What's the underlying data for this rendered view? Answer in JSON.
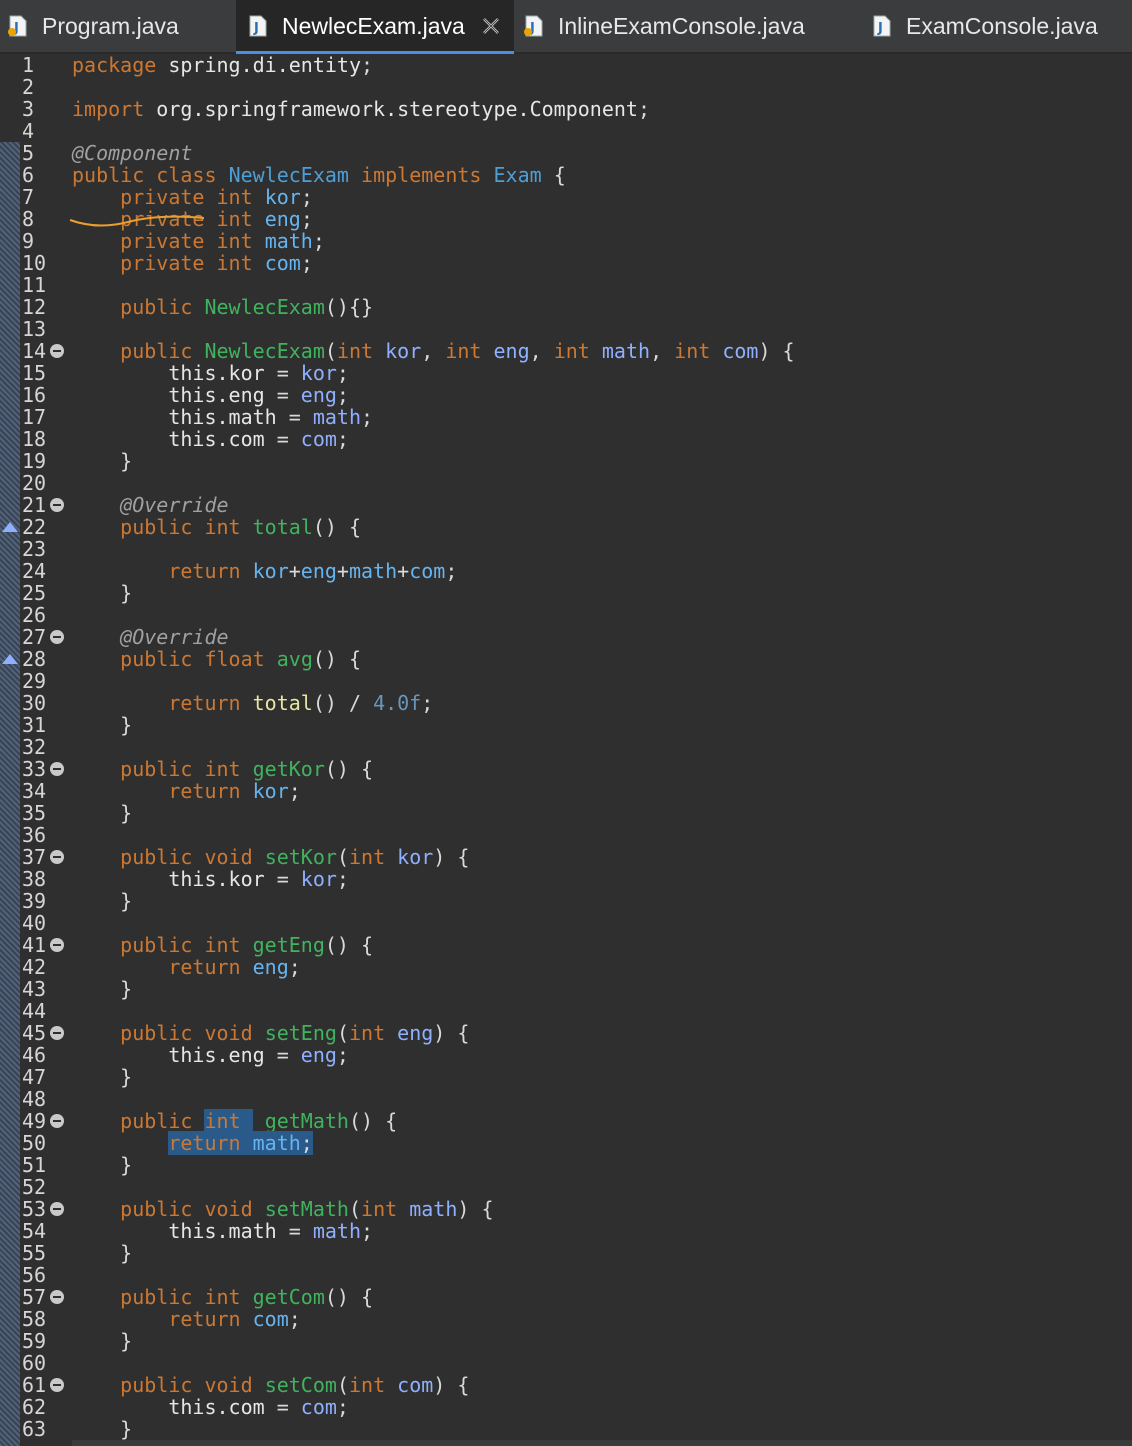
{
  "tabs": [
    {
      "label": "Program.java",
      "active": false,
      "warning": true
    },
    {
      "label": "NewlecExam.java",
      "active": true,
      "closable": true
    },
    {
      "label": "InlineExamConsole.java",
      "active": false,
      "warning": true
    },
    {
      "label": "ExamConsole.java",
      "active": false
    }
  ],
  "colors": {
    "background": "#2f2f2f",
    "keyword": "#cc7832",
    "method": "#3fb35d",
    "field": "#66b4ef",
    "param": "#8fb0ff",
    "selection": "#2a5a8a"
  },
  "icons": {
    "file": "java-file-icon",
    "close": "close-icon",
    "fold": "collapse-icon",
    "override": "override-marker-icon"
  },
  "lines": [
    {
      "n": "1",
      "text": "package spring.di.entity;"
    },
    {
      "n": "2",
      "text": ""
    },
    {
      "n": "3",
      "text": "import org.springframework.stereotype.Component;"
    },
    {
      "n": "4",
      "text": ""
    },
    {
      "n": "5",
      "text": "@Component"
    },
    {
      "n": "6",
      "text": "public class NewlecExam implements Exam {"
    },
    {
      "n": "7",
      "text": "    private int kor;"
    },
    {
      "n": "8",
      "text": "    private int eng;"
    },
    {
      "n": "9",
      "text": "    private int math;"
    },
    {
      "n": "10",
      "text": "    private int com;"
    },
    {
      "n": "11",
      "text": ""
    },
    {
      "n": "12",
      "text": "    public NewlecExam(){}"
    },
    {
      "n": "13",
      "text": ""
    },
    {
      "n": "14",
      "text": "    public NewlecExam(int kor, int eng, int math, int com) {"
    },
    {
      "n": "15",
      "text": "        this.kor = kor;"
    },
    {
      "n": "16",
      "text": "        this.eng = eng;"
    },
    {
      "n": "17",
      "text": "        this.math = math;"
    },
    {
      "n": "18",
      "text": "        this.com = com;"
    },
    {
      "n": "19",
      "text": "    }"
    },
    {
      "n": "20",
      "text": ""
    },
    {
      "n": "21",
      "text": "    @Override"
    },
    {
      "n": "22",
      "text": "    public int total() {"
    },
    {
      "n": "23",
      "text": ""
    },
    {
      "n": "24",
      "text": "        return kor+eng+math+com;"
    },
    {
      "n": "25",
      "text": "    }"
    },
    {
      "n": "26",
      "text": ""
    },
    {
      "n": "27",
      "text": "    @Override"
    },
    {
      "n": "28",
      "text": "    public float avg() {"
    },
    {
      "n": "29",
      "text": ""
    },
    {
      "n": "30",
      "text": "        return total() / 4.0f;"
    },
    {
      "n": "31",
      "text": "    }"
    },
    {
      "n": "32",
      "text": ""
    },
    {
      "n": "33",
      "text": "    public int getKor() {"
    },
    {
      "n": "34",
      "text": "        return kor;"
    },
    {
      "n": "35",
      "text": "    }"
    },
    {
      "n": "36",
      "text": ""
    },
    {
      "n": "37",
      "text": "    public void setKor(int kor) {"
    },
    {
      "n": "38",
      "text": "        this.kor = kor;"
    },
    {
      "n": "39",
      "text": "    }"
    },
    {
      "n": "40",
      "text": ""
    },
    {
      "n": "41",
      "text": "    public int getEng() {"
    },
    {
      "n": "42",
      "text": "        return eng;"
    },
    {
      "n": "43",
      "text": "    }"
    },
    {
      "n": "44",
      "text": ""
    },
    {
      "n": "45",
      "text": "    public void setEng(int eng) {"
    },
    {
      "n": "46",
      "text": "        this.eng = eng;"
    },
    {
      "n": "47",
      "text": "    }"
    },
    {
      "n": "48",
      "text": ""
    },
    {
      "n": "49",
      "text": "    public int getMath() {"
    },
    {
      "n": "50",
      "text": "        return math;"
    },
    {
      "n": "51",
      "text": "    }"
    },
    {
      "n": "52",
      "text": ""
    },
    {
      "n": "53",
      "text": "    public void setMath(int math) {"
    },
    {
      "n": "54",
      "text": "        this.math = math;"
    },
    {
      "n": "55",
      "text": "    }"
    },
    {
      "n": "56",
      "text": ""
    },
    {
      "n": "57",
      "text": "    public int getCom() {"
    },
    {
      "n": "58",
      "text": "        return com;"
    },
    {
      "n": "59",
      "text": "    }"
    },
    {
      "n": "60",
      "text": ""
    },
    {
      "n": "61",
      "text": "    public void setCom(int com) {"
    },
    {
      "n": "62",
      "text": "        this.com = com;"
    },
    {
      "n": "63",
      "text": "    }"
    }
  ],
  "folds": [
    "14",
    "21",
    "27",
    "33",
    "37",
    "41",
    "45",
    "49",
    "53",
    "57",
    "61"
  ],
  "overrides": [
    "22",
    "28"
  ],
  "selection": {
    "line": "50",
    "note": "selected text spans from 'int' on line 49 to end of line 50"
  }
}
